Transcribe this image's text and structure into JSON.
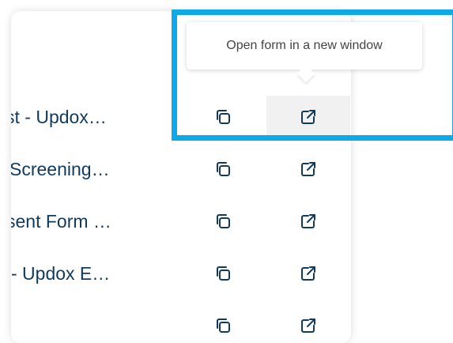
{
  "tooltip": {
    "text": "Open form in a new window"
  },
  "rows": [
    {
      "name": "st - Updox…",
      "copy_icon": "copy-icon",
      "open_icon": "open-external-icon"
    },
    {
      "name": "Screening…",
      "copy_icon": "copy-icon",
      "open_icon": "open-external-icon"
    },
    {
      "name": "sent Form …",
      "copy_icon": "copy-icon",
      "open_icon": "open-external-icon"
    },
    {
      "name": "- Updox E…",
      "copy_icon": "copy-icon",
      "open_icon": "open-external-icon"
    },
    {
      "name": "",
      "copy_icon": "copy-icon",
      "open_icon": "open-external-icon"
    }
  ],
  "colors": {
    "highlight": "#0eaae8",
    "text": "#123a5c",
    "hover_bg": "#f1f1f1"
  }
}
